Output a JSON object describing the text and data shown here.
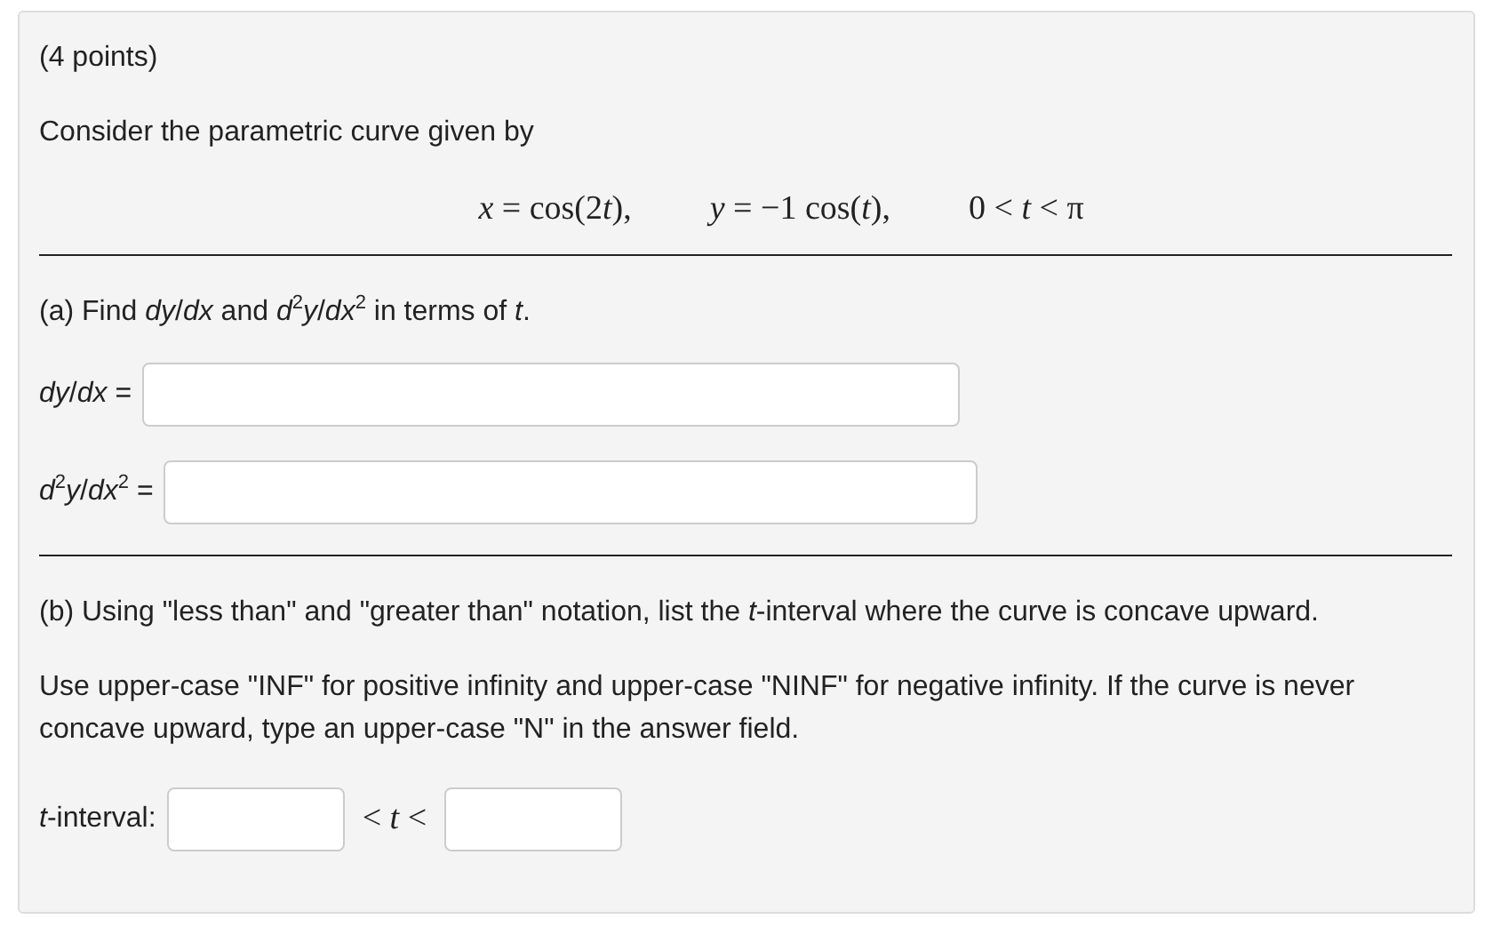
{
  "points": "(4 points)",
  "intro": "Consider the parametric curve given by",
  "equations": [
    [
      {
        "text": "x",
        "italic": true
      },
      {
        "text": " = cos(2",
        "italic": false
      },
      {
        "text": "t",
        "italic": true
      },
      {
        "text": "),",
        "italic": false
      }
    ],
    [
      {
        "text": "y",
        "italic": true
      },
      {
        "text": " = −1 cos(",
        "italic": false
      },
      {
        "text": "t",
        "italic": true
      },
      {
        "text": "),",
        "italic": false
      }
    ],
    [
      {
        "text": "0 < ",
        "italic": false
      },
      {
        "text": "t",
        "italic": true
      },
      {
        "text": " < π",
        "italic": false
      }
    ]
  ],
  "part_a": {
    "prompt": "(a) Find *dy*/*dx* and *d*$^{2}$*y*/*dx*$^{2}$ in terms of *t*.",
    "answers": [
      {
        "label": "*dy*/*dx* ="
      },
      {
        "label": "*d*$^{2}$*y*/*dx*$^{2}$ ="
      }
    ]
  },
  "part_b": {
    "prompt": "(b) Using \"less than\" and \"greater than\" notation, list the *t*-interval where the curve is concave upward.",
    "note": "Use upper-case \"INF\" for positive infinity and upper-case \"NINF\" for negative infinity. If the curve is never concave upward, type an upper-case \"N\" in the answer field.",
    "interval": {
      "label": "*t*-interval:",
      "between": "< *t* <"
    }
  }
}
